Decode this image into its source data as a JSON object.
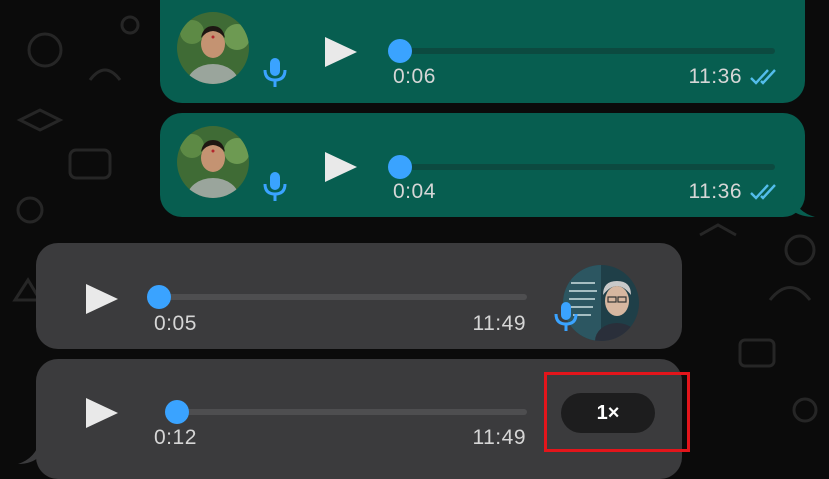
{
  "messages": [
    {
      "direction": "outgoing",
      "duration": "0:06",
      "time": "11:36",
      "status": "read",
      "progress": 0
    },
    {
      "direction": "outgoing",
      "duration": "0:04",
      "time": "11:36",
      "status": "read",
      "progress": 0
    },
    {
      "direction": "incoming",
      "duration": "0:05",
      "time": "11:49",
      "progress": 0
    },
    {
      "direction": "incoming",
      "duration": "0:12",
      "time": "11:49",
      "progress": 0,
      "playback_speed": "1×"
    }
  ],
  "colors": {
    "outgoing_bubble": "#075e50",
    "incoming_bubble": "#3b3b3d",
    "progress_knob": "#3aa3ff",
    "read_ticks": "#53bdeb",
    "highlight_box": "#e3151b"
  },
  "icons": [
    "play-icon",
    "microphone-icon",
    "double-check-icon"
  ]
}
